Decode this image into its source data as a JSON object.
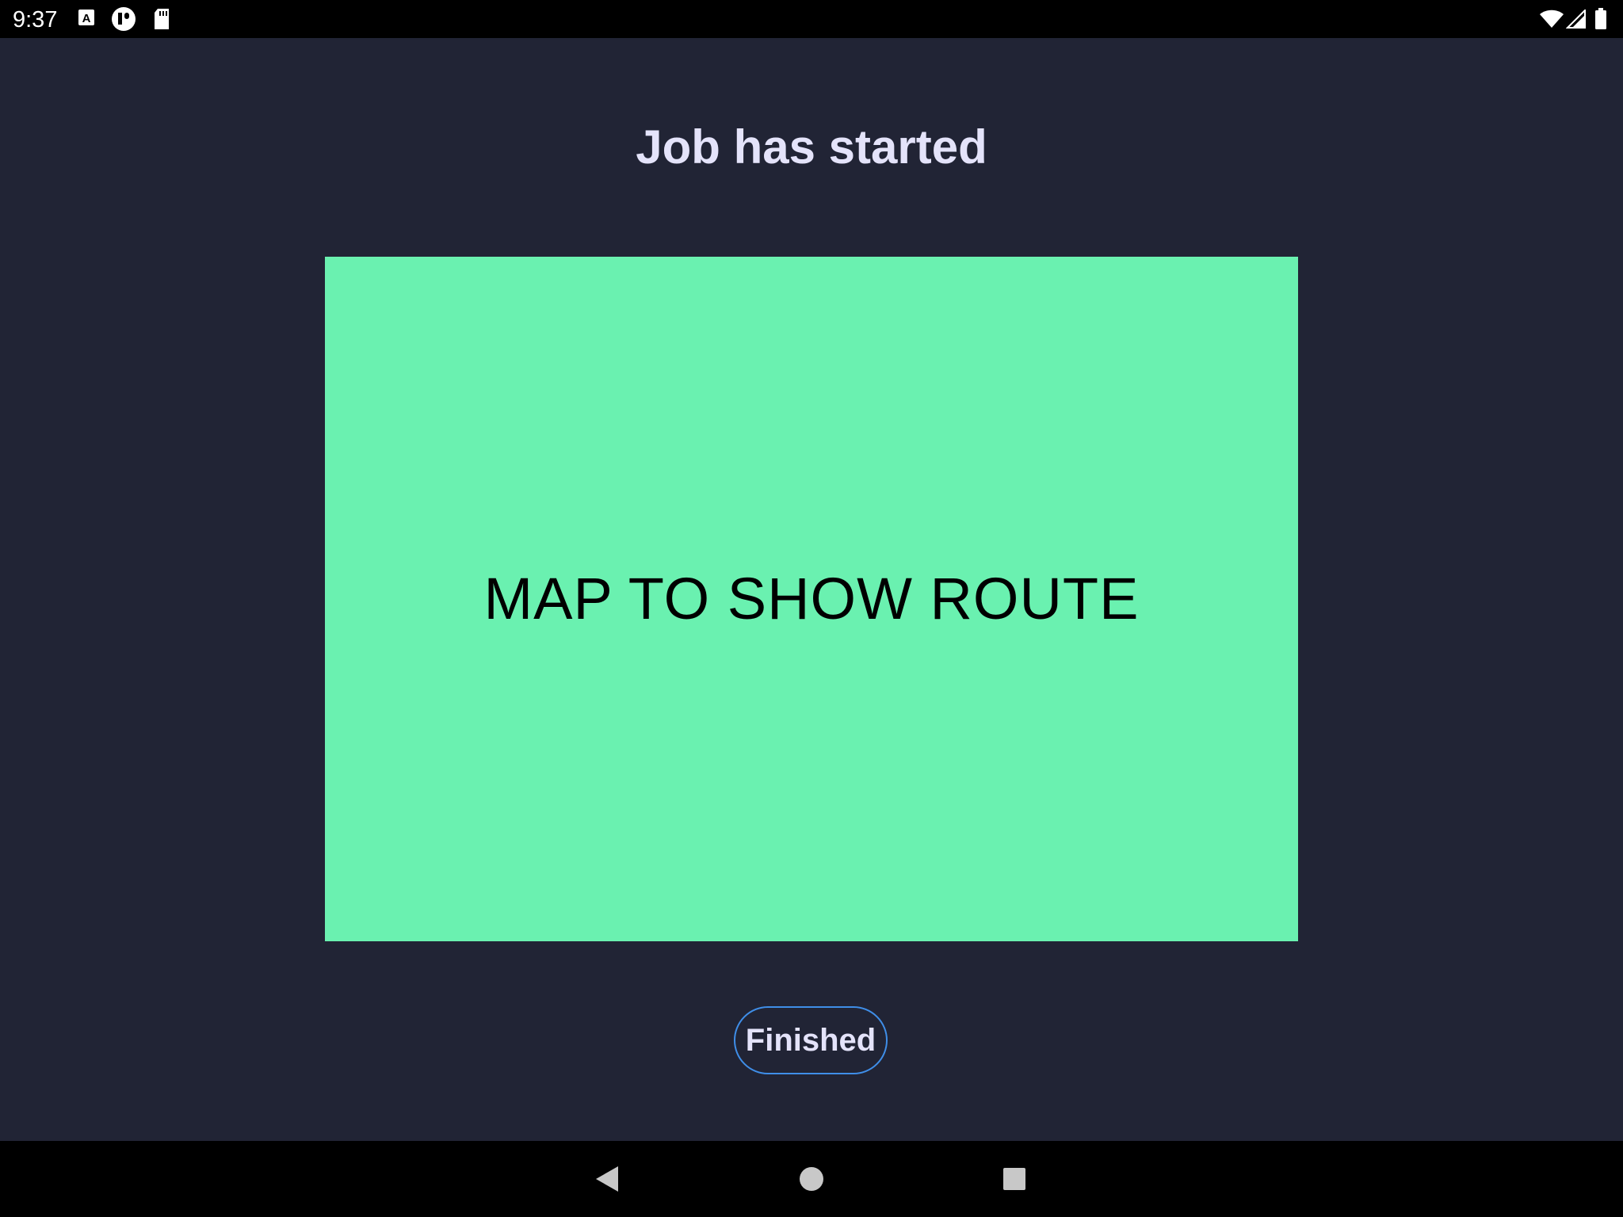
{
  "status_bar": {
    "time": "9:37",
    "left_icons": [
      "auto-text-icon",
      "app-badge-icon",
      "sd-card-icon"
    ],
    "right_icons": [
      "wifi-icon",
      "signal-icon",
      "battery-icon"
    ]
  },
  "screen": {
    "title": "Job has started",
    "map_placeholder": "MAP TO SHOW ROUTE",
    "finished_button_label": "Finished"
  },
  "nav_bar": {
    "buttons": [
      "back-icon",
      "home-icon",
      "recents-icon"
    ]
  },
  "colors": {
    "background": "#212435",
    "title_text": "#e4e3fa",
    "map_fill": "#6af1b0",
    "button_outline": "#3f8ee8",
    "system_bars": "#000000"
  }
}
